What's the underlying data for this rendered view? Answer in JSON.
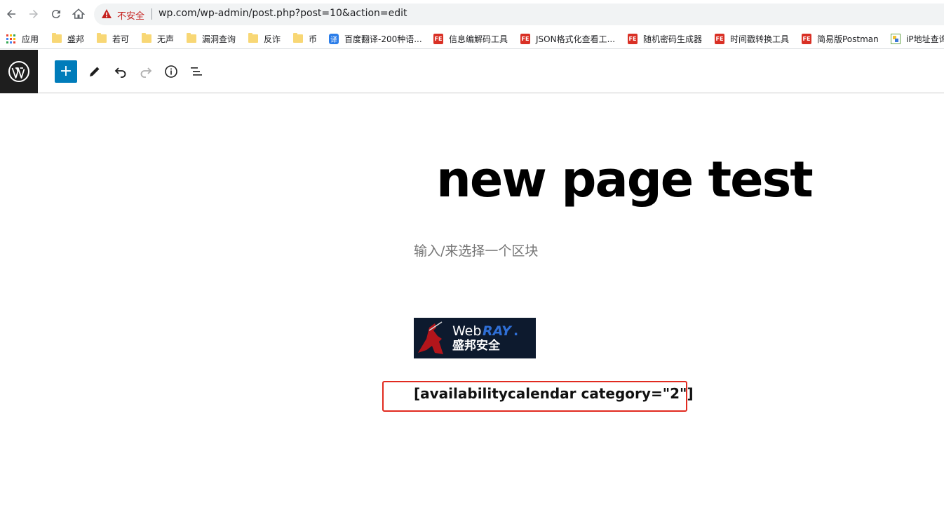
{
  "browser": {
    "security_label": "不安全",
    "url": "wp.com/wp-admin/post.php?post=10&action=edit"
  },
  "bookmarks": [
    {
      "label": "应用",
      "icon": "apps-grid-icon"
    },
    {
      "label": "盛邦",
      "icon": "folder-icon"
    },
    {
      "label": "若可",
      "icon": "folder-icon"
    },
    {
      "label": "无声",
      "icon": "folder-icon"
    },
    {
      "label": "漏洞查询",
      "icon": "folder-icon"
    },
    {
      "label": "反诈",
      "icon": "folder-icon"
    },
    {
      "label": "币",
      "icon": "folder-icon"
    },
    {
      "label": "百度翻译-200种语...",
      "icon": "translate-icon"
    },
    {
      "label": "信息编解码工具",
      "icon": "fe-tool-icon"
    },
    {
      "label": "JSON格式化查看工...",
      "icon": "fe-tool-icon"
    },
    {
      "label": "随机密码生成器",
      "icon": "fe-tool-icon"
    },
    {
      "label": "时间戳转换工具",
      "icon": "fe-tool-icon"
    },
    {
      "label": "简易版Postman",
      "icon": "fe-tool-icon"
    },
    {
      "label": "iP地址查询",
      "icon": "ip-lookup-icon"
    }
  ],
  "icons": {
    "fe_icon_text": "FE",
    "translate_icon_text": "译"
  },
  "editor": {
    "add_block_symbol": "+",
    "post_title": "new page test",
    "block_placeholder": "输入/来选择一个区块",
    "shortcode": "[availabilitycalendar category=\"2\"]"
  },
  "image_block": {
    "brand_latin_prefix": "Web",
    "brand_latin_suffix": "RAY",
    "brand_cn": "盛邦安全",
    "brand_mark": "."
  },
  "colors": {
    "wp_blue": "#007cba",
    "highlight_red": "#e12a1f",
    "insecure_red": "#c5221f"
  }
}
